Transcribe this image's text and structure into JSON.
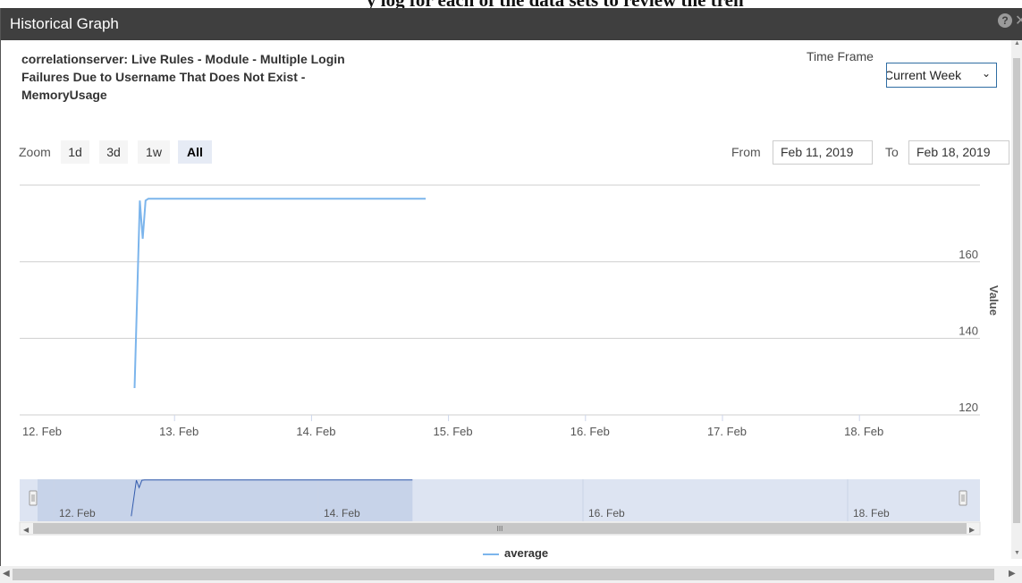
{
  "background_heading": "y log for each of the data sets to review the tren",
  "window": {
    "title": "Historical Graph",
    "help_icon": "question-circle-icon",
    "help_glyph": "?",
    "close_icon": "close-icon",
    "close_glyph": "✕"
  },
  "graph_title": "correlationserver: Live Rules - Module - Multiple Login Failures Due to Username That Does Not Exist - MemoryUsage",
  "time_frame": {
    "label": "Time Frame",
    "selected": "Current Week",
    "chevron": "⌄"
  },
  "zoom": {
    "label": "Zoom",
    "buttons": [
      {
        "label": "1d",
        "active": false
      },
      {
        "label": "3d",
        "active": false
      },
      {
        "label": "1w",
        "active": false
      },
      {
        "label": "All",
        "active": true
      }
    ]
  },
  "range": {
    "from_label": "From",
    "from_value": "Feb 11, 2019",
    "to_label": "To",
    "to_value": "Feb 18, 2019"
  },
  "legend": {
    "series": "average"
  },
  "navigator": {
    "grip": "III"
  },
  "scrollbars": {
    "up": "▲",
    "down": "▼",
    "left": "◀",
    "right": "▶"
  },
  "colors": {
    "series": "#7cb5ec",
    "titlebar": "#3f3f3f",
    "navigator_mask": "rgba(102,133,194,0.3)",
    "select_border": "#2f6da3"
  },
  "chart_data": {
    "type": "line",
    "x_unit": "date (Feb 2019)",
    "ylabel": "Value",
    "x_ticks": [
      "12. Feb",
      "13. Feb",
      "14. Feb",
      "15. Feb",
      "16. Feb",
      "17. Feb",
      "18. Feb"
    ],
    "y_ticks": [
      120,
      140,
      160
    ],
    "xlim": [
      "2019-02-12 00:00",
      "2019-02-19 00:00"
    ],
    "ylim": [
      120,
      180
    ],
    "grid": true,
    "legend": "bottom-center",
    "series": [
      {
        "name": "average",
        "points": [
          [
            "2019-02-12 17:00",
            127
          ],
          [
            "2019-02-12 17:55",
            176
          ],
          [
            "2019-02-12 18:25",
            166
          ],
          [
            "2019-02-12 18:55",
            176
          ],
          [
            "2019-02-12 19:25",
            176.5
          ],
          [
            "2019-02-14 20:00",
            176.5
          ]
        ]
      }
    ],
    "navigator": {
      "x_ticks": [
        "12. Feb",
        "14. Feb",
        "16. Feb",
        "18. Feb"
      ],
      "selected_range": [
        "2019-02-12 00:00",
        "2019-02-14 20:00"
      ]
    }
  }
}
